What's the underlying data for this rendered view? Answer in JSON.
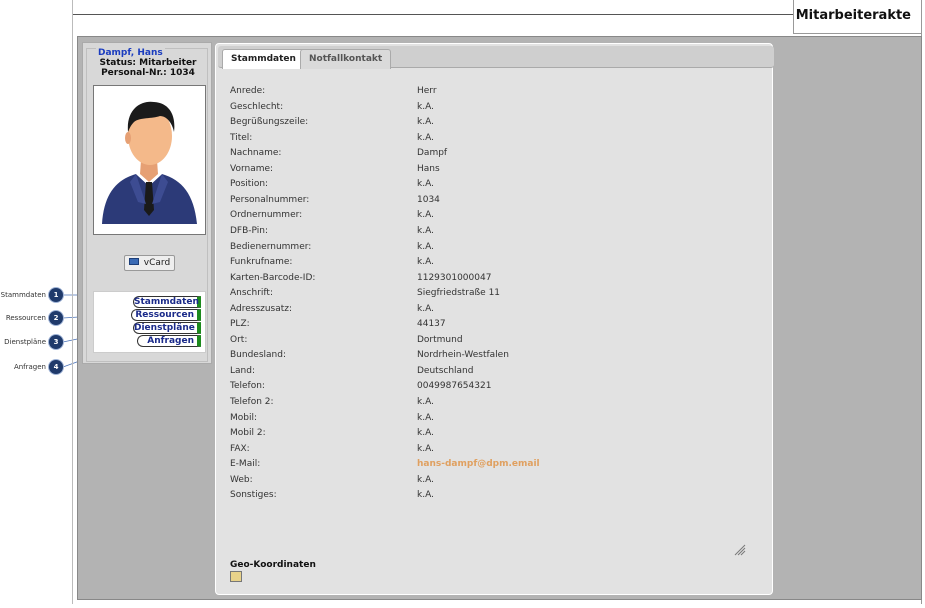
{
  "header": {
    "title": "Mitarbeiterakte"
  },
  "annotations": [
    {
      "num": "1",
      "label": "Stammdaten"
    },
    {
      "num": "2",
      "label": "Ressourcen"
    },
    {
      "num": "3",
      "label": "Dienstpläne"
    },
    {
      "num": "4",
      "label": "Anfragen"
    }
  ],
  "person": {
    "name": "Dampf, Hans",
    "status": "Status: Mitarbeiter",
    "personal_nr": "Personal-Nr.: 1034",
    "vcard_label": "vCard"
  },
  "nav": [
    {
      "label": "Stammdaten"
    },
    {
      "label": "Ressourcen"
    },
    {
      "label": "Dienstpläne"
    },
    {
      "label": "Anfragen"
    }
  ],
  "tabs": [
    {
      "label": "Stammdaten",
      "active": true
    },
    {
      "label": "Notfallkontakt",
      "active": false
    }
  ],
  "fields": [
    {
      "label": "Anrede:",
      "value": "Herr"
    },
    {
      "label": "Geschlecht:",
      "value": "k.A."
    },
    {
      "label": "Begrüßungszeile:",
      "value": "k.A."
    },
    {
      "label": "Titel:",
      "value": "k.A."
    },
    {
      "label": "Nachname:",
      "value": "Dampf"
    },
    {
      "label": "Vorname:",
      "value": "Hans"
    },
    {
      "label": "Position:",
      "value": "k.A."
    },
    {
      "label": "Personalnummer:",
      "value": "1034"
    },
    {
      "label": "Ordnernummer:",
      "value": "k.A."
    },
    {
      "label": "DFB-Pin:",
      "value": "k.A."
    },
    {
      "label": "Bedienernummer:",
      "value": "k.A."
    },
    {
      "label": "Funkrufname:",
      "value": "k.A."
    },
    {
      "label": "Karten-Barcode-ID:",
      "value": "1129301000047"
    },
    {
      "label": "Anschrift:",
      "value": "Siegfriedstraße 11"
    },
    {
      "label": "Adresszusatz:",
      "value": "k.A."
    },
    {
      "label": "PLZ:",
      "value": "44137"
    },
    {
      "label": "Ort:",
      "value": "Dortmund"
    },
    {
      "label": "Bundesland:",
      "value": "Nordrhein-Westfalen"
    },
    {
      "label": "Land:",
      "value": "Deutschland"
    },
    {
      "label": "Telefon:",
      "value": "0049987654321"
    },
    {
      "label": "Telefon 2:",
      "value": "k.A."
    },
    {
      "label": "Mobil:",
      "value": "k.A."
    },
    {
      "label": "Mobil 2:",
      "value": "k.A."
    },
    {
      "label": "FAX:",
      "value": "k.A."
    },
    {
      "label": "E-Mail:",
      "value": "hans-dampf@dpm.email"
    },
    {
      "label": "Web:",
      "value": "k.A."
    },
    {
      "label": "Sonstiges:",
      "value": "k.A."
    }
  ],
  "geo": {
    "label": "Geo-Koordinaten",
    "icon": "map-icon"
  },
  "colors": {
    "accent_name": "#1a3cbf",
    "email": "#e0a060",
    "nav_marker": "#1d8a1d",
    "annotation": "#1f3a6b"
  }
}
